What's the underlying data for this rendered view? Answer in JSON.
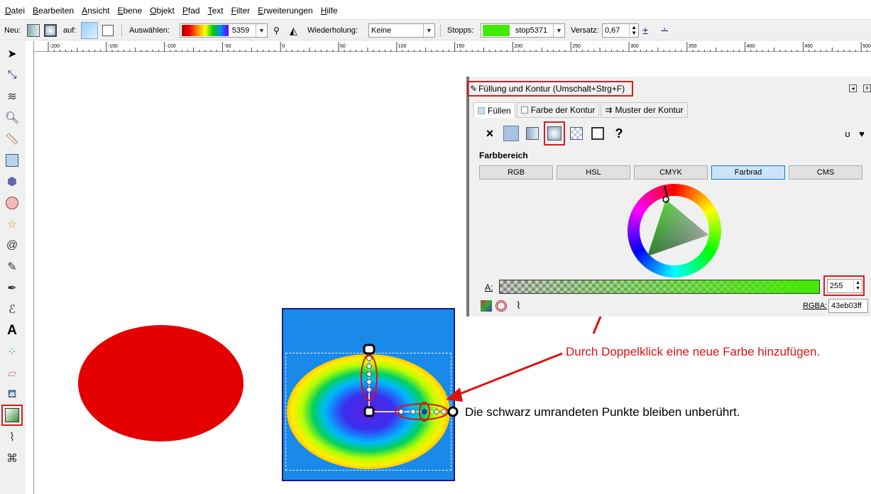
{
  "menu": [
    "Datei",
    "Bearbeiten",
    "Ansicht",
    "Ebene",
    "Objekt",
    "Pfad",
    "Text",
    "Filter",
    "Erweiterungen",
    "Hilfe"
  ],
  "toolbar": {
    "new_label": "Neu:",
    "on_label": "auf:",
    "select_label": "Auswählen:",
    "gradient_id": "5359",
    "repeat_label": "Wiederholung:",
    "repeat_value": "Keine",
    "stops_label": "Stopps:",
    "stop_value": "stop5371",
    "stop_color": "#43eb03",
    "offset_label": "Versatz:",
    "offset_value": "0,67"
  },
  "ruler": {
    "labels": [
      "-200",
      "-150",
      "-100",
      "-50",
      "0",
      "50",
      "100",
      "150",
      "200",
      "250",
      "300",
      "350",
      "400",
      "450",
      "500"
    ]
  },
  "tools": [
    "selector-arrow-icon",
    "node-editor-icon",
    "tweak-icon",
    "zoom-icon",
    "measure-icon",
    "rectangle-icon",
    "box3d-icon",
    "circle-icon",
    "star-icon",
    "spiral-icon",
    "pencil-icon",
    "pen-icon",
    "calligraphy-icon",
    "text-icon",
    "spray-icon",
    "eraser-icon",
    "bucket-icon",
    "gradient-icon",
    "dropper-icon",
    "connector-icon"
  ],
  "dialog": {
    "title": "Füllung und Kontur (Umschalt+Strg+F)",
    "tabs": [
      "Füllen",
      "Farbe der Kontur",
      "Muster der Kontur"
    ],
    "section": "Farbbereich",
    "color_modes": [
      "RGB",
      "HSL",
      "CMYK",
      "Farbrad",
      "CMS"
    ],
    "active_mode": "Farbrad",
    "alpha_label": "A:",
    "alpha_value": "255",
    "rgba_label": "RGBA:",
    "rgba_value": "43eb03ff",
    "unknown_symbol": "?",
    "none_symbol": "×"
  },
  "annotations": {
    "doubleclick": "Durch Doppelklick eine neue Farbe hinzufügen.",
    "black_points": "Die schwarz umrandeten Punkte bleiben unberührt."
  },
  "colors": {
    "annotation_red": "#e01010",
    "red_shape": "#e50000",
    "blue_square": "#1a8aea",
    "active_mode_bg": "#cce4f7"
  }
}
